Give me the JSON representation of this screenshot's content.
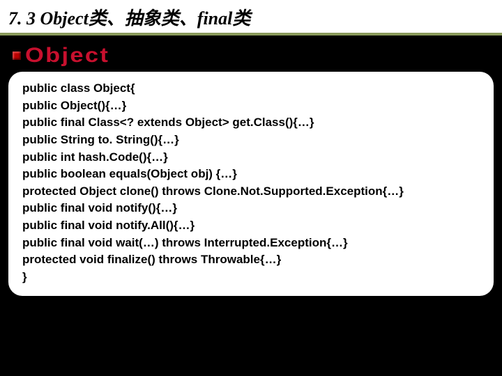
{
  "header": {
    "title": "7. 3 Object类、抽象类、final类"
  },
  "section": {
    "title": "Object"
  },
  "code": {
    "lines": [
      "public class Object{",
      "public Object(){…}",
      "public final  Class<? extends Object>  get.Class(){…}",
      "public String   to. String(){…}",
      "public int  hash.Code(){…}",
      "public boolean  equals(Object obj) {…}",
      "protected Object  clone() throws Clone.Not.Supported.Exception{…}",
      "public final void   notify(){…}",
      "public final void   notify.All(){…}",
      "public final void   wait(…) throws Interrupted.Exception{…}",
      "protected void   finalize() throws Throwable{…}",
      "}"
    ]
  }
}
